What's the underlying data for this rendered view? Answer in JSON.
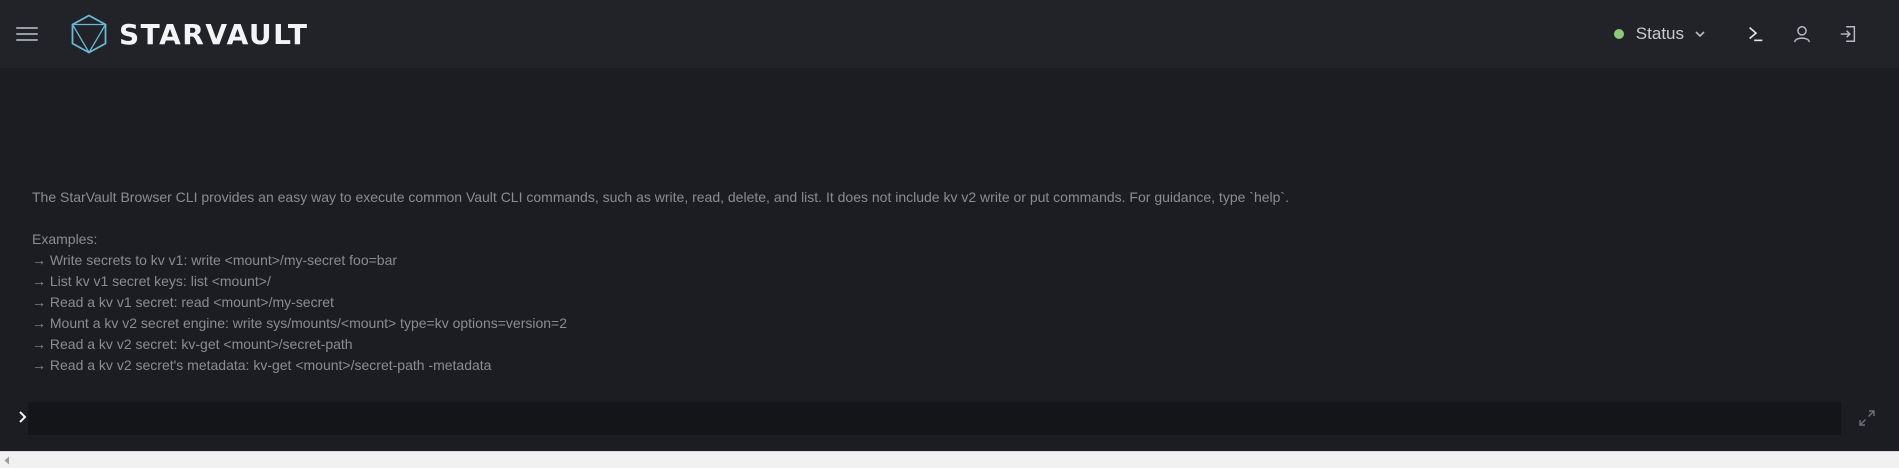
{
  "header": {
    "brand_name": "STARVAULT",
    "logo_icon": "hexagon-cube-logo",
    "status_label": "Status",
    "status_color": "#8cc97b",
    "icons": [
      "menu-icon",
      "terminal-icon",
      "user-icon",
      "sign-out-icon"
    ]
  },
  "console": {
    "intro": "The StarVault Browser CLI provides an easy way to execute common Vault CLI commands, such as write, read, delete, and list. It does not include kv v2 write or put commands. For guidance, type `help`.",
    "examples_title": "Examples:",
    "examples": [
      "→ Write secrets to kv v1: write <mount>/my-secret foo=bar",
      "→ List kv v1 secret keys: list <mount>/",
      "→ Read a kv v1 secret: read <mount>/my-secret",
      "→ Mount a kv v2 secret engine: write sys/mounts/<mount> type=kv options=version=2",
      "→ Read a kv v2 secret: kv-get <mount>/secret-path",
      "→ Read a kv v2 secret's metadata: kv-get <mount>/secret-path -metadata"
    ],
    "input_value": ""
  },
  "colors": {
    "background": "#1c1d22",
    "topbar": "#222329",
    "accent": "#6ab7d6"
  }
}
